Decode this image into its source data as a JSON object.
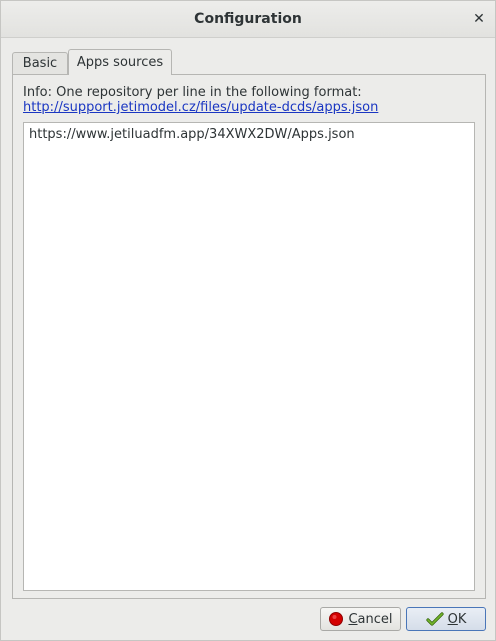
{
  "window": {
    "title": "Configuration",
    "close_glyph": "✕"
  },
  "tabs": [
    {
      "label": "Basic",
      "active": false
    },
    {
      "label": "Apps sources",
      "active": true
    }
  ],
  "apps_sources": {
    "info_text": "Info: One repository per line in the following format:",
    "format_link": "http://support.jetimodel.cz/files/update-dcds/apps.json",
    "repositories_text": "https://www.jetiluadfm.app/34XWX2DW/Apps.json"
  },
  "buttons": {
    "cancel": {
      "mnemonic": "C",
      "rest": "ancel",
      "icon": "cancel-icon"
    },
    "ok": {
      "mnemonic": "O",
      "rest": "K",
      "icon": "ok-check-icon"
    }
  },
  "colors": {
    "link": "#1a36c2",
    "cancel_icon": "#d40000",
    "ok_icon": "#4e9a06"
  }
}
